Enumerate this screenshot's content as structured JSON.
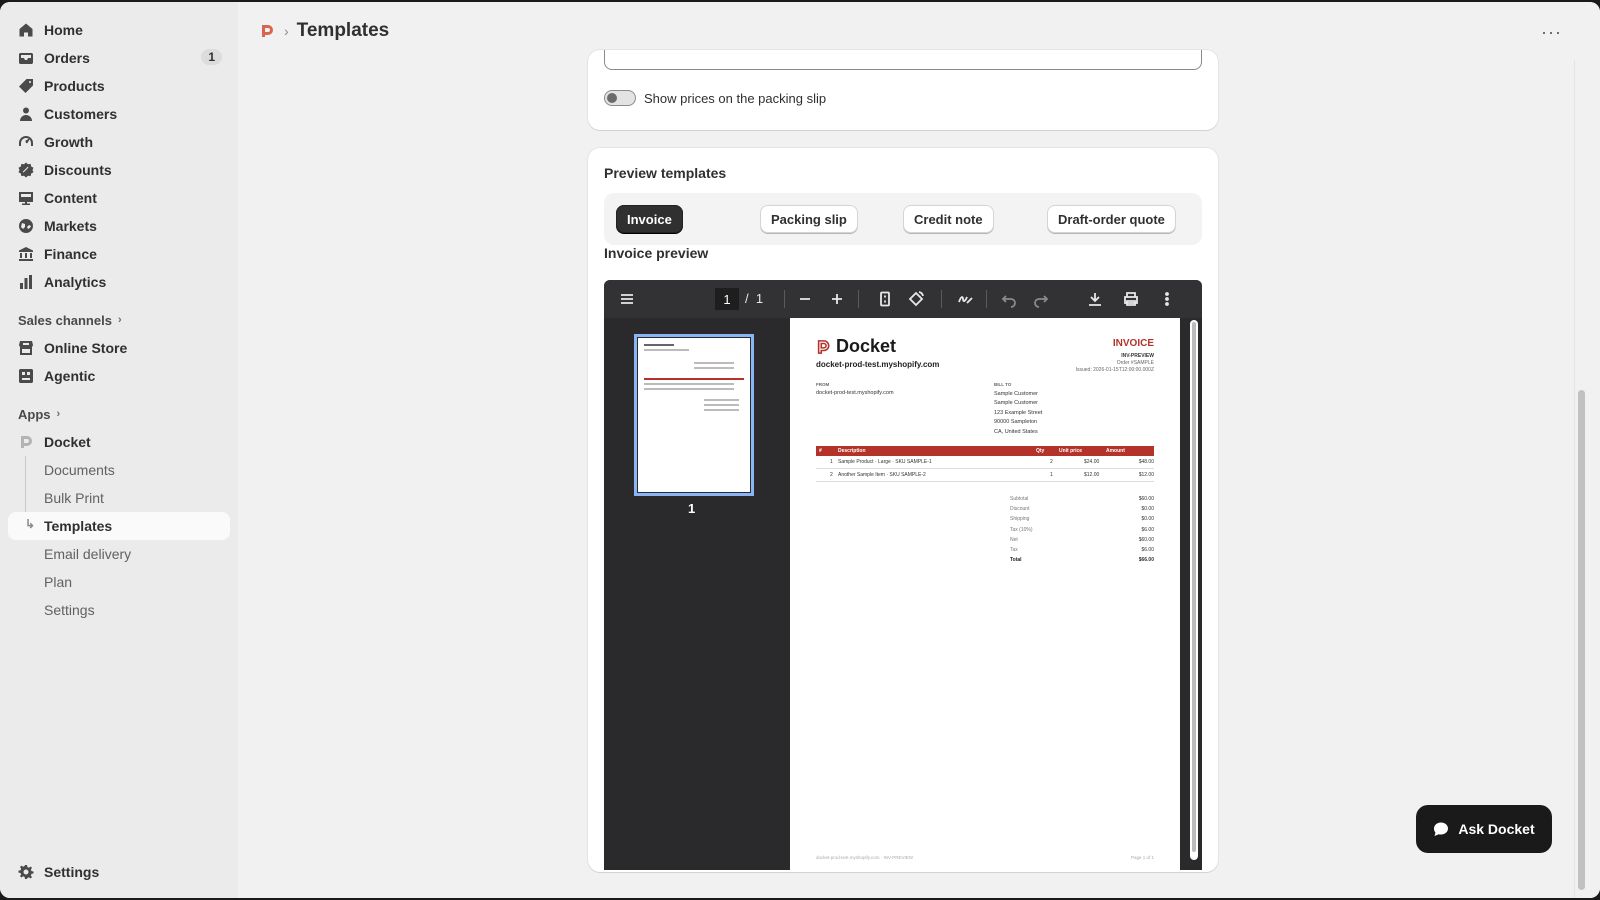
{
  "sidebar": {
    "items": [
      {
        "label": "Home",
        "icon": "home-icon"
      },
      {
        "label": "Orders",
        "icon": "inbox-icon",
        "badge": "1"
      },
      {
        "label": "Products",
        "icon": "tag-icon"
      },
      {
        "label": "Customers",
        "icon": "person-icon"
      },
      {
        "label": "Growth",
        "icon": "gauge-icon"
      },
      {
        "label": "Discounts",
        "icon": "discount-icon"
      },
      {
        "label": "Content",
        "icon": "monitor-icon"
      },
      {
        "label": "Markets",
        "icon": "globe-icon"
      },
      {
        "label": "Finance",
        "icon": "bank-icon"
      },
      {
        "label": "Analytics",
        "icon": "bar-chart-icon"
      }
    ],
    "sales_channels_label": "Sales channels",
    "sales_channels": [
      {
        "label": "Online Store",
        "icon": "store-icon"
      },
      {
        "label": "Agentic",
        "icon": "agent-icon"
      }
    ],
    "apps_label": "Apps",
    "app_name": "Docket",
    "app_subitems": [
      "Documents",
      "Bulk Print",
      "Templates",
      "Email delivery",
      "Plan",
      "Settings"
    ],
    "settings_label": "Settings"
  },
  "topbar": {
    "title": "Templates",
    "separator": "›",
    "more": "···"
  },
  "packing": {
    "toggle_label": "Show prices on the packing slip"
  },
  "preview": {
    "title": "Preview templates",
    "tabs": [
      "Invoice",
      "Packing slip",
      "Credit note",
      "Draft-order quote"
    ],
    "active_tab": "Invoice",
    "section_label": "Invoice preview"
  },
  "pdf_viewer": {
    "current_page": "1",
    "separator": "/",
    "total_pages": "1",
    "thumb_label": "1"
  },
  "invoice": {
    "brand": "Docket",
    "shop": "docket-prod-test.myshopify.com",
    "title": "INVOICE",
    "number": "INV-PREVIEW",
    "order": "Order #SAMPLE",
    "issued": "Issued: 2026-01-15T12:00:00.000Z",
    "from_label": "FROM",
    "from_value": "docket-prod-test.myshopify.com",
    "billto_label": "BILL TO",
    "billto_lines": [
      "Sample Customer",
      "Sample Customer",
      "123 Example Street",
      "90000 Sampleton",
      "CA, United States"
    ],
    "columns": [
      "#",
      "Description",
      "Qty",
      "Unit price",
      "Amount"
    ],
    "rows": [
      {
        "n": "1",
        "desc": "Sample Product · Large · SKU SAMPLE-1",
        "qty": "2",
        "unit": "$24.00",
        "amount": "$48.00"
      },
      {
        "n": "2",
        "desc": "Another Sample Item · SKU SAMPLE-2",
        "qty": "1",
        "unit": "$12.00",
        "amount": "$12.00"
      }
    ],
    "totals": [
      {
        "label": "Subtotal",
        "value": "$60.00"
      },
      {
        "label": "Discount",
        "value": "$0.00"
      },
      {
        "label": "Shipping",
        "value": "$0.00"
      },
      {
        "label": "Tax (10%)",
        "value": "$6.00"
      },
      {
        "label": "Net",
        "value": "$60.00"
      },
      {
        "label": "Tax",
        "value": "$6.00"
      },
      {
        "label": "Total",
        "value": "$66.00"
      }
    ],
    "footer_left": "docket-prod-test.myshopify.com · INV-PREVIEW",
    "footer_right": "Page 1 of 1"
  },
  "ask_button": "Ask Docket",
  "colors": {
    "accent": "#b3332b",
    "dark": "#303030",
    "selected_thumb": "#8ab4f8"
  }
}
